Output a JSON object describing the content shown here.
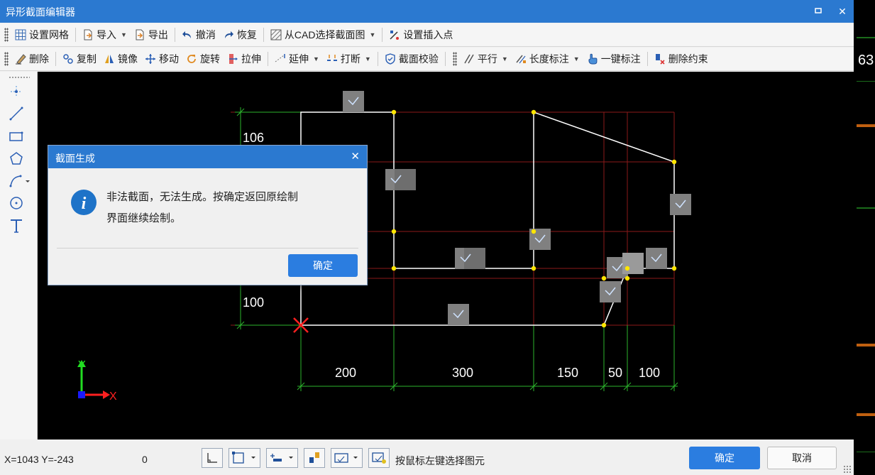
{
  "window": {
    "title": "异形截面编辑器"
  },
  "toolbar1": {
    "grid": "设置网格",
    "import": "导入",
    "export": "导出",
    "undo": "撤消",
    "redo": "恢复",
    "cad_select": "从CAD选择截面图",
    "insert_point": "设置插入点"
  },
  "toolbar2": {
    "delete": "删除",
    "copy": "复制",
    "mirror": "镜像",
    "move": "移动",
    "rotate": "旋转",
    "stretch": "拉伸",
    "extend": "延伸",
    "break": "打断",
    "check": "截面校验",
    "parallel": "平行",
    "length_dim": "长度标注",
    "one_key_dim": "一键标注",
    "delete_constraint": "删除约束"
  },
  "canvas": {
    "dim_left_top": "106",
    "dim_left_bottom": "100",
    "dims_bottom": [
      "200",
      "300",
      "150",
      "50",
      "100"
    ],
    "axis_x": "X",
    "axis_y": "Y",
    "colors": {
      "background": "#000000",
      "grid": "#8b1a1a",
      "outline": "#ffffff",
      "dimension": "#2db52d",
      "vertex": "#ffe600",
      "origin_marker": "#ff2020"
    }
  },
  "dialog": {
    "title": "截面生成",
    "message_line1": "非法截面，无法生成。按确定返回原绘制",
    "message_line2": "界面继续绘制。",
    "ok": "确定"
  },
  "status": {
    "coords": "X=1043 Y=-243",
    "value": "0",
    "hint": "按鼠标左键选择图元",
    "ok": "确定",
    "cancel": "取消"
  },
  "right_strip": {
    "partial_text": "63"
  }
}
